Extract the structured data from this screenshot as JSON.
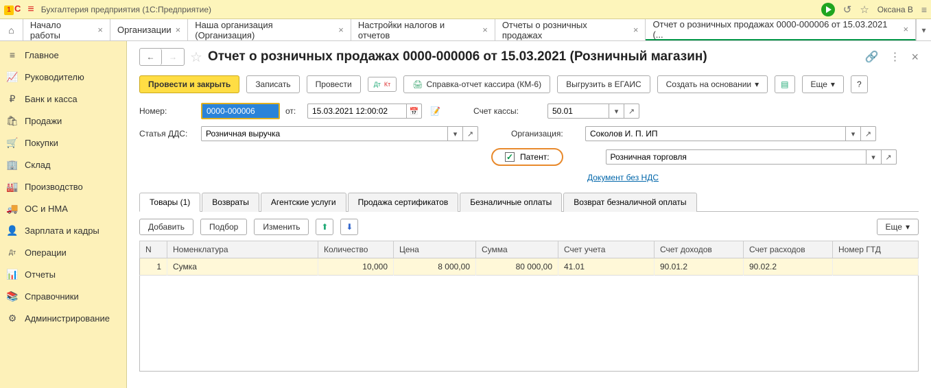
{
  "app": {
    "title": "Бухгалтерия предприятия (1С:Предприятие)",
    "user": "Оксана В"
  },
  "tabs": [
    {
      "label": "Начало работы"
    },
    {
      "label": "Организации"
    },
    {
      "label": "Наша организация (Организация)"
    },
    {
      "label": "Настройки налогов и отчетов"
    },
    {
      "label": "Отчеты о розничных продажах"
    },
    {
      "label": "Отчет о розничных продажах 0000-000006 от 15.03.2021 (..."
    }
  ],
  "sidebar": {
    "items": [
      {
        "icon": "≡",
        "label": "Главное"
      },
      {
        "icon": "📈",
        "label": "Руководителю"
      },
      {
        "icon": "₽",
        "label": "Банк и касса"
      },
      {
        "icon": "🛍",
        "label": "Продажи"
      },
      {
        "icon": "🛒",
        "label": "Покупки"
      },
      {
        "icon": "🏢",
        "label": "Склад"
      },
      {
        "icon": "🏭",
        "label": "Производство"
      },
      {
        "icon": "🚚",
        "label": "ОС и НМА"
      },
      {
        "icon": "👤",
        "label": "Зарплата и кадры"
      },
      {
        "icon": "Дт",
        "label": "Операции"
      },
      {
        "icon": "📊",
        "label": "Отчеты"
      },
      {
        "icon": "📚",
        "label": "Справочники"
      },
      {
        "icon": "⚙",
        "label": "Администрирование"
      }
    ]
  },
  "document": {
    "title": "Отчет о розничных продажах 0000-000006 от 15.03.2021 (Розничный магазин)"
  },
  "buttons": {
    "post_close": "Провести и закрыть",
    "save": "Записать",
    "post": "Провести",
    "report": "Справка-отчет кассира (КМ-6)",
    "egais": "Выгрузить в ЕГАИС",
    "create_based": "Создать на основании",
    "more": "Еще",
    "question": "?",
    "add": "Добавить",
    "pick": "Подбор",
    "edit": "Изменить"
  },
  "form": {
    "number_label": "Номер:",
    "number_value": "0000-000006",
    "from_label": "от:",
    "date_value": "15.03.2021 12:00:02",
    "account_label": "Счет кассы:",
    "account_value": "50.01",
    "dds_label": "Статья ДДС:",
    "dds_value": "Розничная выручка",
    "org_label": "Организация:",
    "org_value": "Соколов И. П. ИП",
    "patent_label": "Патент:",
    "patent_value": "Розничная торговля",
    "vat_link": "Документ без НДС"
  },
  "doc_tabs": [
    "Товары (1)",
    "Возвраты",
    "Агентские услуги",
    "Продажа сертификатов",
    "Безналичные оплаты",
    "Возврат безналичной оплаты"
  ],
  "table": {
    "headers": [
      "N",
      "Номенклатура",
      "Количество",
      "Цена",
      "Сумма",
      "Счет учета",
      "Счет доходов",
      "Счет расходов",
      "Номер ГТД"
    ],
    "rows": [
      {
        "n": "1",
        "name": "Сумка",
        "qty": "10,000",
        "price": "8 000,00",
        "sum": "80 000,00",
        "acc": "41.01",
        "income": "90.01.2",
        "expense": "90.02.2",
        "gtd": ""
      }
    ]
  }
}
